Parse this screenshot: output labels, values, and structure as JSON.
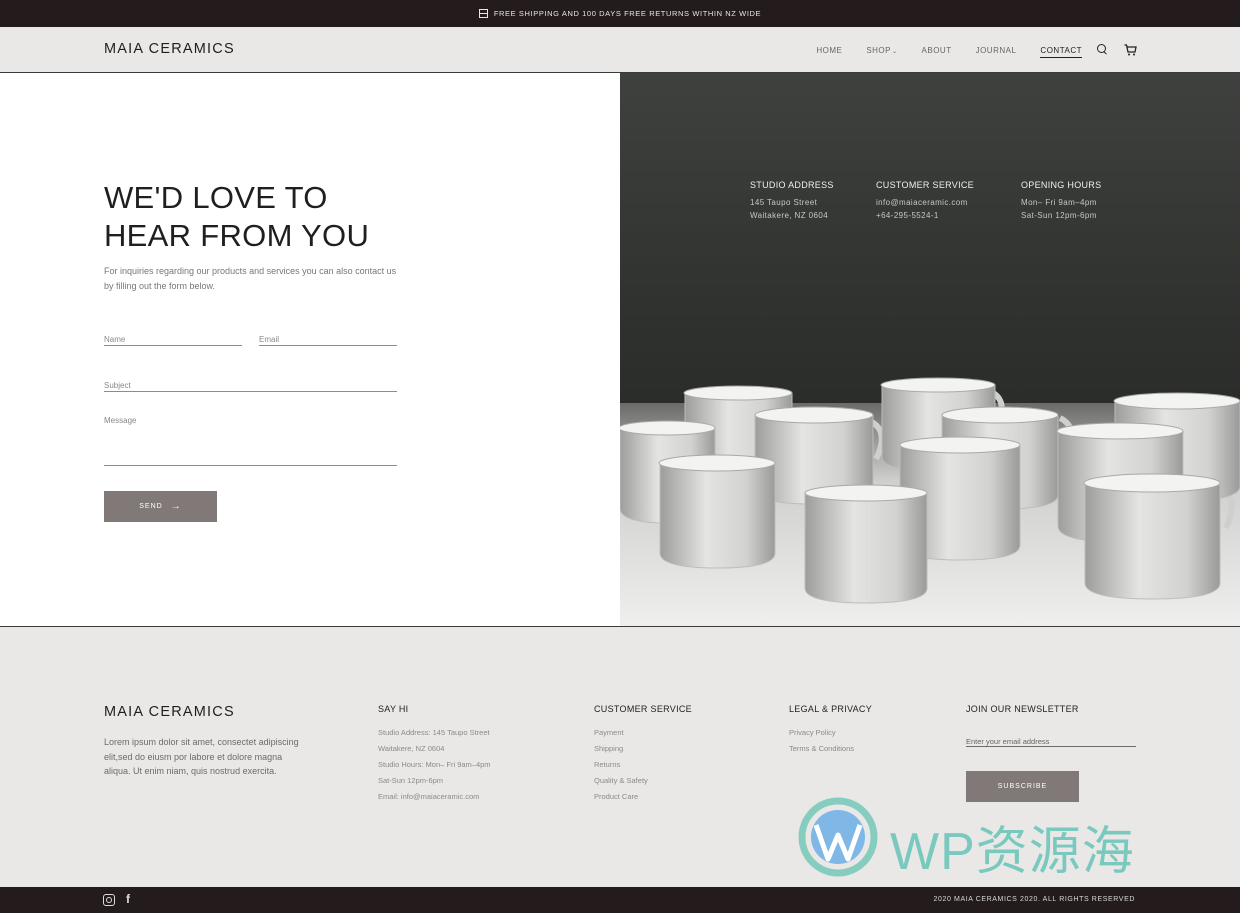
{
  "announcement": {
    "text": "FREE SHIPPING AND 100 DAYS FREE RETURNS WITHIN NZ WIDE"
  },
  "header": {
    "logo": "MAIA CERAMICS",
    "nav": [
      {
        "label": "HOME"
      },
      {
        "label": "SHOP"
      },
      {
        "label": "ABOUT"
      },
      {
        "label": "JOURNAL"
      },
      {
        "label": "CONTACT"
      }
    ],
    "active": "CONTACT"
  },
  "hero": {
    "title_line1": "WE'D LOVE TO",
    "title_line2": "HEAR FROM YOU",
    "description": "For inquiries regarding our products and services you can also contact us by filling out the form below.",
    "form": {
      "name_placeholder": "Name",
      "email_placeholder": "Email",
      "subject_placeholder": "Subject",
      "message_placeholder": "Message",
      "send_label": "SEND"
    },
    "info": [
      {
        "heading": "STUDIO ADDRESS",
        "line1": "145 Taupo Street",
        "line2": "Waitakere, NZ 0604"
      },
      {
        "heading": "CUSTOMER SERVICE",
        "line1": "info@maiaceramic.com",
        "line2": "+64-295-5524-1"
      },
      {
        "heading": "OPENING HOURS",
        "line1": "Mon– Fri 9am–4pm",
        "line2": "Sat-Sun 12pm-6pm"
      }
    ]
  },
  "footer": {
    "logo": "MAIA CERAMICS",
    "about": "Lorem ipsum dolor sit amet, consectet adipiscing elit,sed do eiusm por labore et dolore magna aliqua. Ut enim niam, quis nostrud exercita.",
    "say_hi": {
      "heading": "SAY HI",
      "lines": [
        "Studio Address: 145 Taupo Street",
        "Waitakere, NZ 0604",
        "Studio Hours: Mon– Fri 9am–4pm",
        "Sat-Sun 12pm-6pm",
        "Email: info@maiaceramic.com"
      ]
    },
    "customer_service": {
      "heading": "CUSTOMER SERVICE",
      "links": [
        "Payment",
        "Shipping",
        "Returns",
        "Quality & Safety",
        "Product Care"
      ]
    },
    "legal": {
      "heading": "LEGAL & PRIVACY",
      "links": [
        "Privacy Policy",
        "Terms & Conditions"
      ]
    },
    "newsletter": {
      "heading": "JOIN OUR NEWSLETTER",
      "placeholder": "Enter your email address",
      "button": "SUBSCRIBE"
    },
    "copyright": "2020 MAIA CERAMICS 2020. ALL RIGHTS RESERVED"
  },
  "watermark": {
    "text": "WP资源海"
  },
  "colors": {
    "dark_bar": "#241c1c",
    "header_bg": "#e9e8e6",
    "button": "#807977",
    "watermark": "#7ac9bf"
  }
}
